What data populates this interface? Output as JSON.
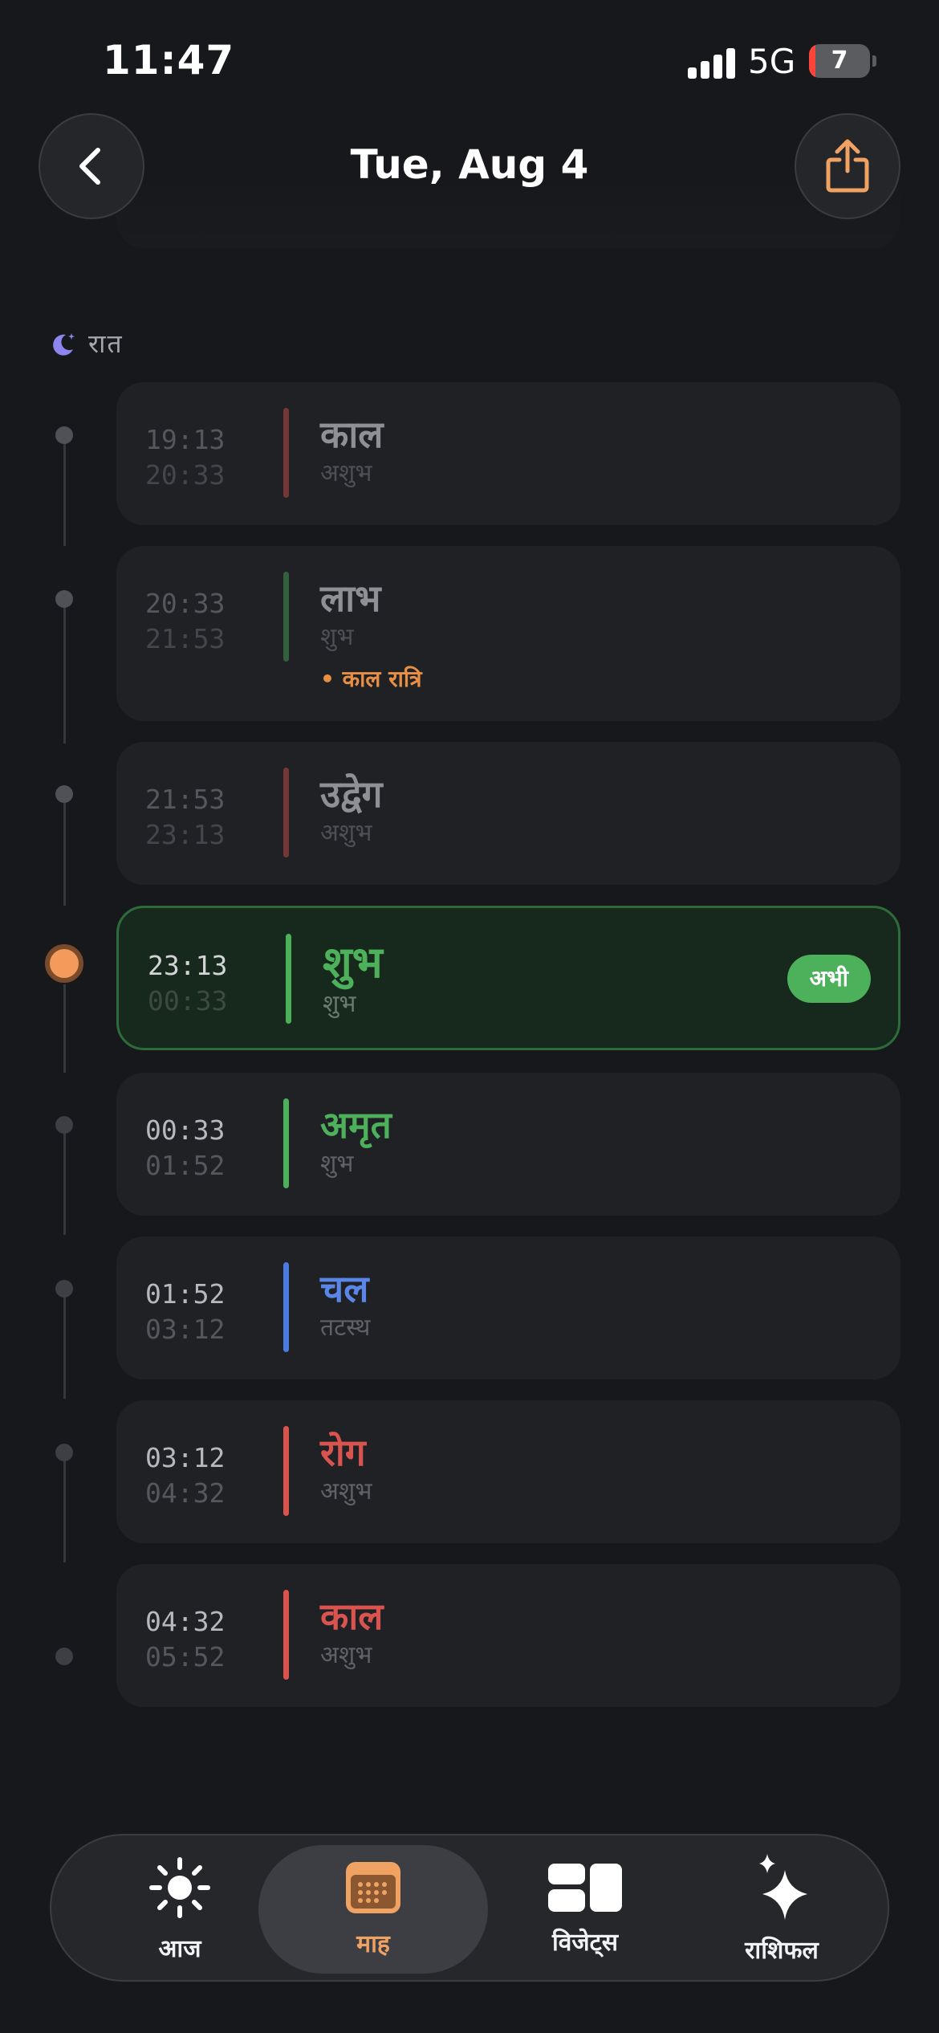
{
  "status_bar": {
    "time": "11:47",
    "network": "5G",
    "battery": "7"
  },
  "header": {
    "title": "Tue, Aug 4"
  },
  "section": {
    "label": "रात"
  },
  "rows": [
    {
      "start": "19:13",
      "end": "20:33",
      "name": "काल",
      "type": "अशुभ",
      "state": "past"
    },
    {
      "start": "20:33",
      "end": "21:53",
      "name": "लाभ",
      "type": "शुभ",
      "note": "• काल रात्रि",
      "state": "past"
    },
    {
      "start": "21:53",
      "end": "23:13",
      "name": "उद्वेग",
      "type": "अशुभ",
      "state": "past"
    },
    {
      "start": "23:13",
      "end": "00:33",
      "name": "शुभ",
      "type": "शुभ",
      "badge": "अभी",
      "state": "current"
    },
    {
      "start": "00:33",
      "end": "01:52",
      "name": "अमृत",
      "type": "शुभ",
      "state": "upcoming"
    },
    {
      "start": "01:52",
      "end": "03:12",
      "name": "चल",
      "type": "तटस्थ",
      "state": "upcoming"
    },
    {
      "start": "03:12",
      "end": "04:32",
      "name": "रोग",
      "type": "अशुभ",
      "state": "upcoming"
    },
    {
      "start": "04:32",
      "end": "05:52",
      "name": "काल",
      "type": "अशुभ",
      "state": "upcoming"
    }
  ],
  "colors": {
    "good": "#4db05a",
    "bad": "#d9534f",
    "neutral": "#4a7be0",
    "accent": "#f39b5b",
    "past_name": "#8f9096"
  },
  "tabbar": {
    "tabs": [
      {
        "label": "आज",
        "icon": "sun-icon"
      },
      {
        "label": "माह",
        "icon": "calendar-icon",
        "active": true
      },
      {
        "label": "विजेट्स",
        "icon": "widgets-icon"
      },
      {
        "label": "राशिफल",
        "icon": "sparkles-icon"
      }
    ]
  }
}
